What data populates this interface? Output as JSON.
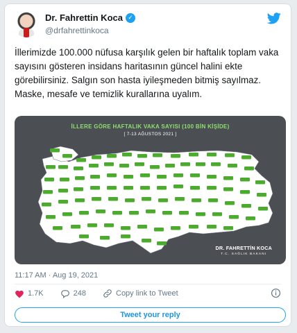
{
  "tweet": {
    "author_name": "Dr. Fahrettin Koca",
    "handle": "@drfahrettinkoca",
    "text": "İllerimizde 100.000 nüfusa karşılık gelen bir haftalık toplam vaka sayısını gösteren insidans haritasının güncel halini ekte görebilirsiniz. Salgın son hasta iyileşmeden bitmiş sayılmaz. Maske, mesafe ve temizlik kurallarına uyalım.",
    "timestamp": "11:17 AM · Aug 19, 2021",
    "likes": "1.7K",
    "replies": "248",
    "copy_link": "Copy link to Tweet",
    "reply_button": "Tweet your reply"
  },
  "map": {
    "title": "İLLERE GÖRE HAFTALIK VAKA SAYISI (100 BİN KİŞİDE)",
    "subtitle": "[ 7-13 AĞUSTOS 2021 ]",
    "signature_name": "DR. FAHRETTİN KOCA",
    "signature_org": "T.C. SAĞLIK BAKANI"
  },
  "icons": {
    "verified": "verified-badge-icon",
    "bird": "twitter-bird-icon",
    "heart": "heart-icon",
    "reply": "reply-bubble-icon",
    "link": "link-icon",
    "info": "info-icon"
  },
  "colors": {
    "accent": "#1da1f2",
    "like": "#e0245e",
    "map_bg": "#4b4f54",
    "map_title": "#8ee06b",
    "map_fill": "#ffffff",
    "tag_fill": "#4cab2e"
  }
}
